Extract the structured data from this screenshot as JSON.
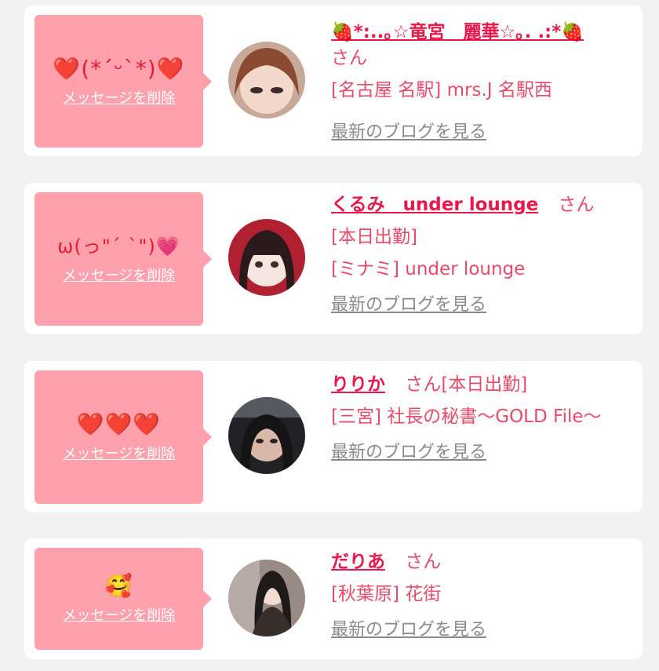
{
  "cards": [
    {
      "stamp": "❤️(*´ᵕ`*)❤️",
      "delete_label": "メッセージを削除",
      "name": "🍓*:..｡☆竜宮　麗華☆｡. .:*🍓",
      "honorific": "さん",
      "line2": "",
      "line3": "[名古屋 名駅] mrs.J 名駅西",
      "blog_label": "最新のブログを見る"
    },
    {
      "stamp": "ω(っ\"ˊ ˋ\")💗",
      "delete_label": "メッセージを削除",
      "name": "くるみ　under lounge",
      "honorific": "さん",
      "line2": "[本日出勤]",
      "line3": "[ミナミ] under lounge",
      "blog_label": "最新のブログを見る"
    },
    {
      "stamp": "❤️❤️❤️",
      "delete_label": "メッセージを削除",
      "name": "りりか",
      "honorific": "さん[本日出勤]",
      "line2": "",
      "line3": "[三宮] 社長の秘書〜GOLD File〜",
      "blog_label": "最新のブログを見る"
    },
    {
      "stamp": "🥰",
      "delete_label": "メッセージを削除",
      "name": "だりあ",
      "honorific": "さん",
      "line2": "",
      "line3": "[秋葉原] 花街",
      "blog_label": "最新のブログを見る"
    }
  ],
  "colors": {
    "bubble": "#ffa1ad",
    "name": "#e8194a",
    "text": "#e84a6a",
    "link_gray": "#8a8a8a"
  }
}
